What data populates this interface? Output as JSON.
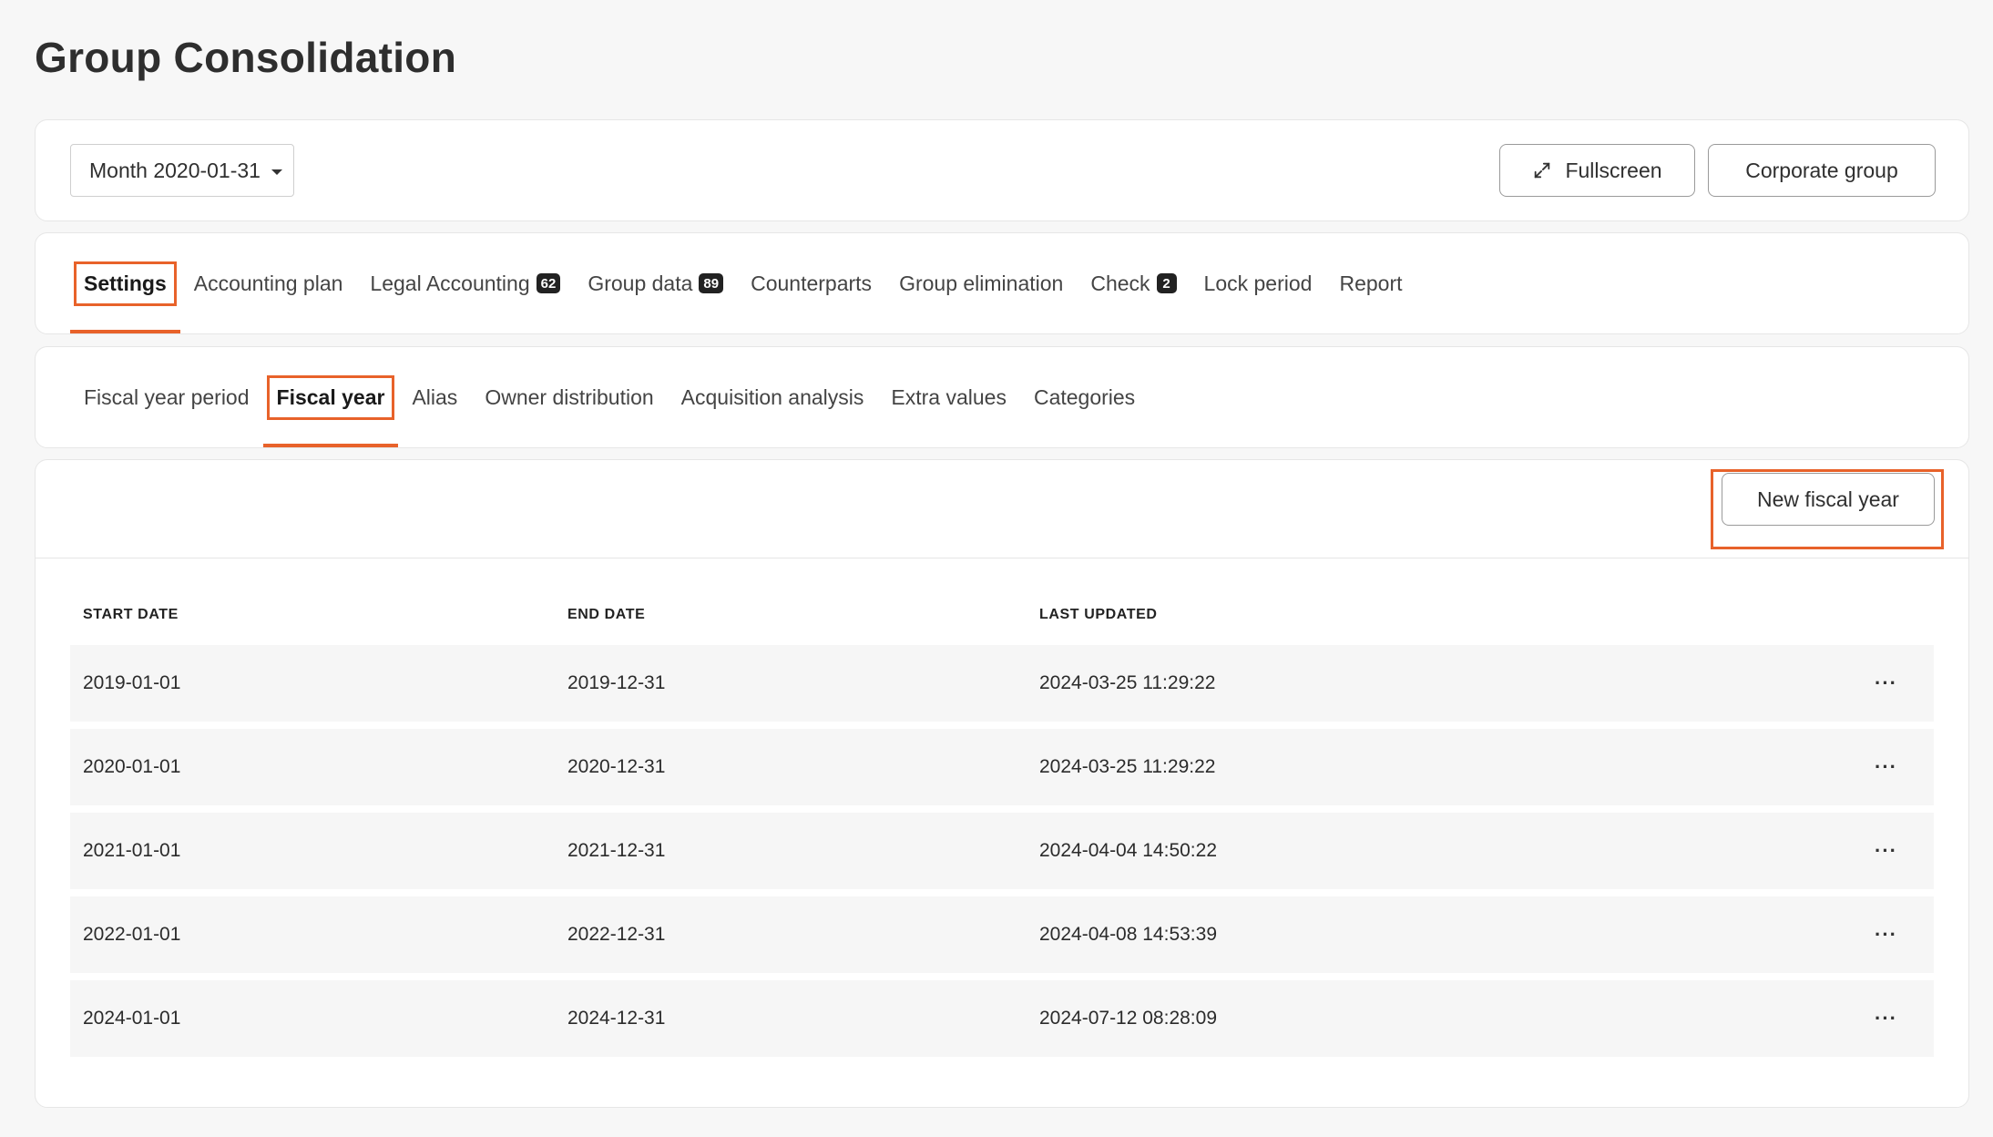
{
  "page": {
    "title": "Group Consolidation"
  },
  "toolbar": {
    "period": "Month 2020-01-31",
    "fullscreen_label": "Fullscreen",
    "corporate_group_label": "Corporate group"
  },
  "tabs": [
    {
      "label": "Settings",
      "active": true
    },
    {
      "label": "Accounting plan"
    },
    {
      "label": "Legal Accounting",
      "badge": "62"
    },
    {
      "label": "Group data",
      "badge": "89"
    },
    {
      "label": "Counterparts"
    },
    {
      "label": "Group elimination"
    },
    {
      "label": "Check",
      "badge": "2"
    },
    {
      "label": "Lock period"
    },
    {
      "label": "Report"
    }
  ],
  "subtabs": [
    {
      "label": "Fiscal year period"
    },
    {
      "label": "Fiscal year",
      "active": true
    },
    {
      "label": "Alias"
    },
    {
      "label": "Owner distribution"
    },
    {
      "label": "Acquisition analysis"
    },
    {
      "label": "Extra values"
    },
    {
      "label": "Categories"
    }
  ],
  "main": {
    "new_fiscal_year_label": "New fiscal year",
    "columns": [
      "START DATE",
      "END DATE",
      "LAST UPDATED"
    ],
    "rows": [
      {
        "start": "2019-01-01",
        "end": "2019-12-31",
        "updated": "2024-03-25 11:29:22"
      },
      {
        "start": "2020-01-01",
        "end": "2020-12-31",
        "updated": "2024-03-25 11:29:22"
      },
      {
        "start": "2021-01-01",
        "end": "2021-12-31",
        "updated": "2024-04-04 14:50:22"
      },
      {
        "start": "2022-01-01",
        "end": "2022-12-31",
        "updated": "2024-04-08 14:53:39"
      },
      {
        "start": "2024-01-01",
        "end": "2024-12-31",
        "updated": "2024-07-12 08:28:09"
      }
    ],
    "row_action_label": "···"
  },
  "colors": {
    "accent": "#e8622a",
    "badge": "#222222"
  }
}
